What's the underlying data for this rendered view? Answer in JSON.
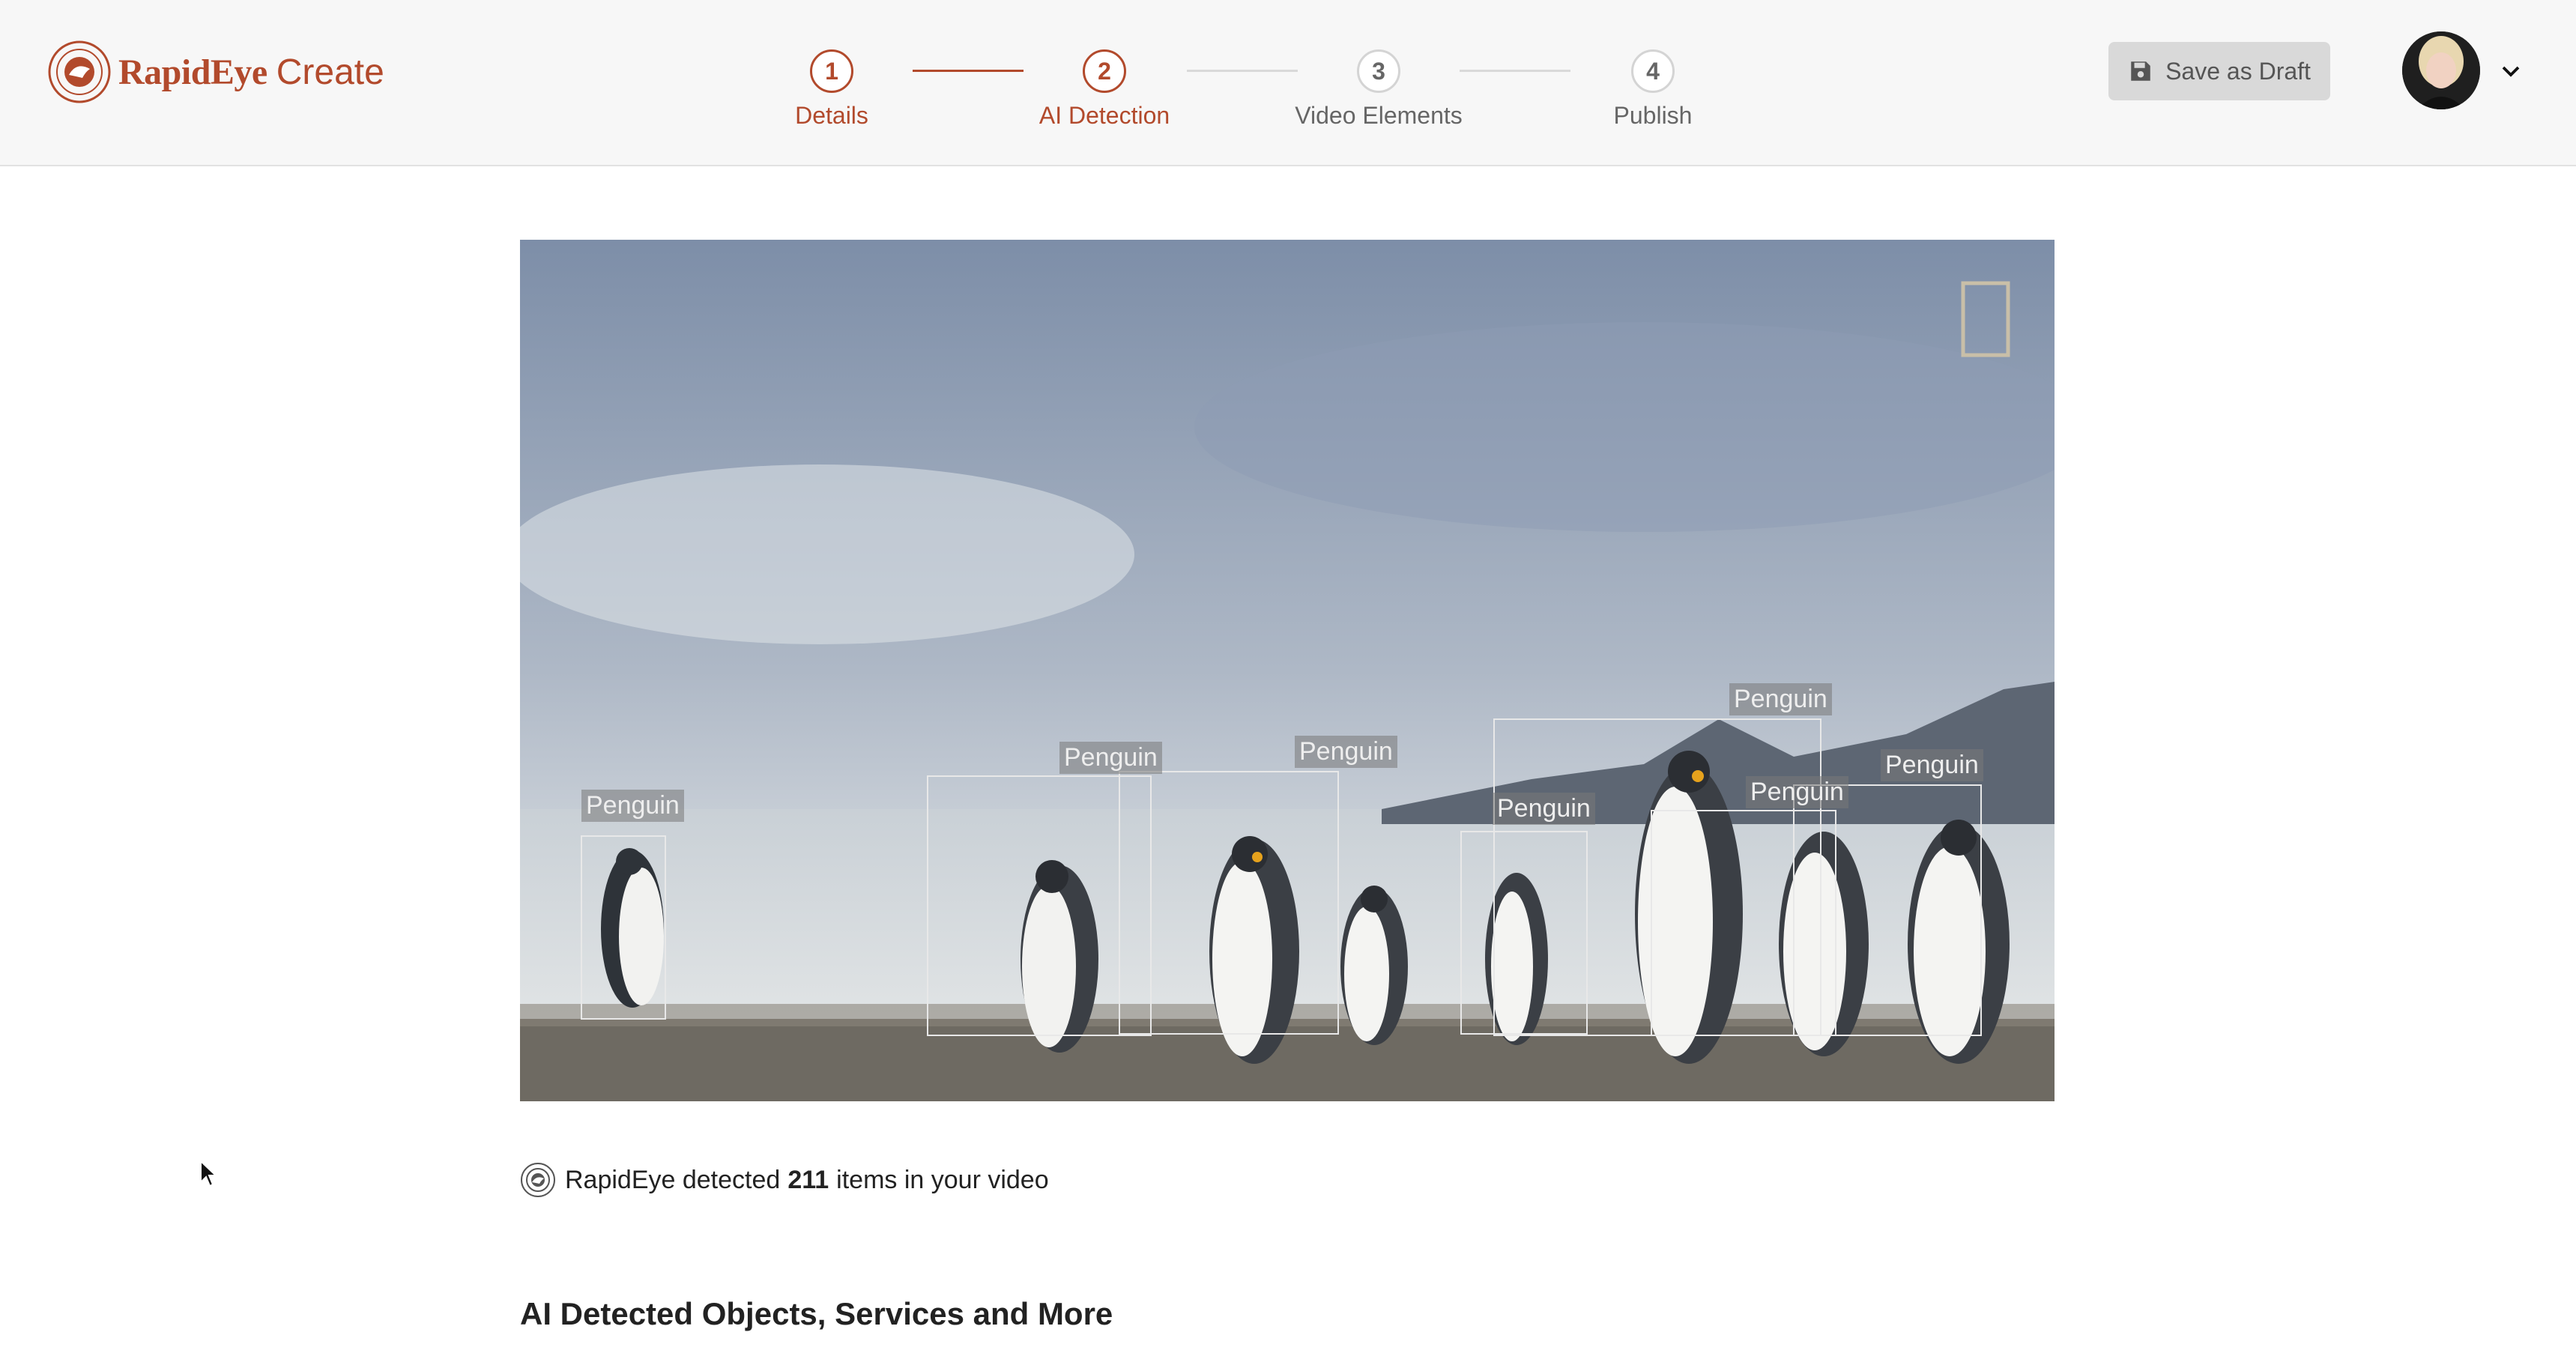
{
  "app": {
    "brand_name": "RapidEye",
    "brand_suffix": "Create",
    "accent_color": "#b24a2c"
  },
  "stepper": {
    "current_step": 2,
    "steps": [
      {
        "number": "1",
        "label": "Details",
        "state": "complete"
      },
      {
        "number": "2",
        "label": "AI Detection",
        "state": "active"
      },
      {
        "number": "3",
        "label": "Video Elements",
        "state": "upcoming"
      },
      {
        "number": "4",
        "label": "Publish",
        "state": "upcoming"
      }
    ]
  },
  "header": {
    "save_label": "Save as Draft",
    "save_icon": "floppy-disk-icon",
    "user_menu_icon": "chevron-down-icon"
  },
  "video": {
    "detections": [
      {
        "label": "Penguin"
      },
      {
        "label": "Penguin"
      },
      {
        "label": "Penguin"
      },
      {
        "label": "Penguin"
      },
      {
        "label": "Penguin"
      },
      {
        "label": "Penguin"
      },
      {
        "label": "Penguin"
      }
    ]
  },
  "summary": {
    "prefix": "RapidEye detected",
    "count": "211",
    "suffix": "items in your video"
  },
  "section": {
    "title": "AI Detected Objects, Services and More"
  }
}
